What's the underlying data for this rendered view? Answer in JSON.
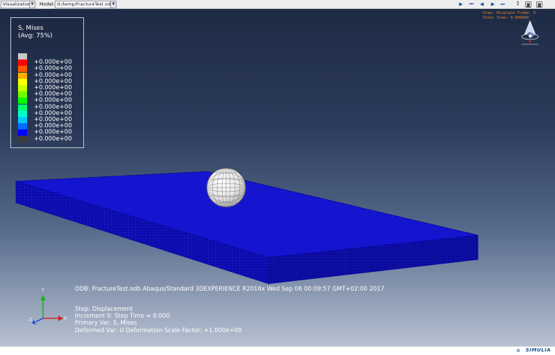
{
  "toolbar": {
    "module_select": "Visualization",
    "model_label": "Model:",
    "model_select": "d:/temp/FractureTest.odb",
    "buttons": [
      {
        "name": "play-button",
        "glyph": "▶"
      },
      {
        "name": "first-frame-button",
        "glyph": "⏮"
      },
      {
        "name": "previous-frame-button",
        "glyph": "◀"
      },
      {
        "name": "next-frame-button",
        "glyph": "▶"
      },
      {
        "name": "last-frame-button",
        "glyph": "⏭"
      },
      {
        "name": "animation-options-button",
        "glyph": "⁑"
      },
      {
        "name": "camera-button",
        "glyph": "◙"
      },
      {
        "name": "capture-button",
        "glyph": "◙"
      }
    ]
  },
  "legend": {
    "title_line1": "S, Mises",
    "title_line2": "(Avg: 75%)",
    "entries": [
      {
        "color": "#c8c8c8",
        "label": ""
      },
      {
        "color": "#ff0000",
        "label": "+0.000e+00"
      },
      {
        "color": "#ff5a00",
        "label": "+0.000e+00"
      },
      {
        "color": "#ffb000",
        "label": "+0.000e+00"
      },
      {
        "color": "#ffff00",
        "label": "+0.000e+00"
      },
      {
        "color": "#c8ff00",
        "label": "+0.000e+00"
      },
      {
        "color": "#6eff00",
        "label": "+0.000e+00"
      },
      {
        "color": "#00ff00",
        "label": "+0.000e+00"
      },
      {
        "color": "#00ff6e",
        "label": "+0.000e+00"
      },
      {
        "color": "#00ffc8",
        "label": "+0.000e+00"
      },
      {
        "color": "#00c8ff",
        "label": "+0.000e+00"
      },
      {
        "color": "#006eff",
        "label": "+0.000e+00"
      },
      {
        "color": "#0000ff",
        "label": "+0.000e+00"
      },
      {
        "color": "#3c3c3c",
        "label": "+0.000e+00"
      }
    ]
  },
  "step_info": {
    "line1": "Step: Displace Frame: 0",
    "line2": "Total Time: 0.000000"
  },
  "triad": {
    "x": "X",
    "y": "Y",
    "z": "Z"
  },
  "info": {
    "odb_line": "ODB: FractureTest.odb    Abaqus/Standard 3DEXPERIENCE R2016x    Wed Sep 06 00:09:57 GMT+02:00 2017",
    "step_line": "Step: Displacement",
    "increment_line": "Increment      0: Step Time =      0.000",
    "primary_line": "Primary Var: S, Mises",
    "deformed_line": "Deformed Var: U   Deformation Scale Factor: +1.000e+00"
  },
  "status": {
    "brand": "SIMULIA"
  },
  "colors": {
    "plate": "#1010cc",
    "ball": "#f0f0f0",
    "accent": "#e8822a"
  }
}
